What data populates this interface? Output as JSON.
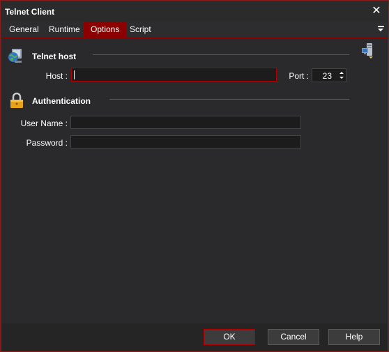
{
  "window": {
    "title": "Telnet Client"
  },
  "tabs": [
    {
      "label": "General"
    },
    {
      "label": "Runtime"
    },
    {
      "label": "Options",
      "active": true
    },
    {
      "label": "Script"
    }
  ],
  "telnet_host": {
    "title": "Telnet host",
    "host_label": "Host :",
    "host_value": "",
    "port_label": "Port :",
    "port_value": "23"
  },
  "authentication": {
    "title": "Authentication",
    "username_label": "User Name :",
    "username_value": "",
    "password_label": "Password :",
    "password_value": ""
  },
  "buttons": {
    "ok": "OK",
    "cancel": "Cancel",
    "help": "Help"
  },
  "colors": {
    "accent": "#8b0000",
    "background": "#2d2d30",
    "input_bg": "#1c1c1c"
  },
  "icons": {
    "host_section": "globe-computer-icon",
    "auth_section": "padlock-icon",
    "corner": "network-computer-icon"
  }
}
